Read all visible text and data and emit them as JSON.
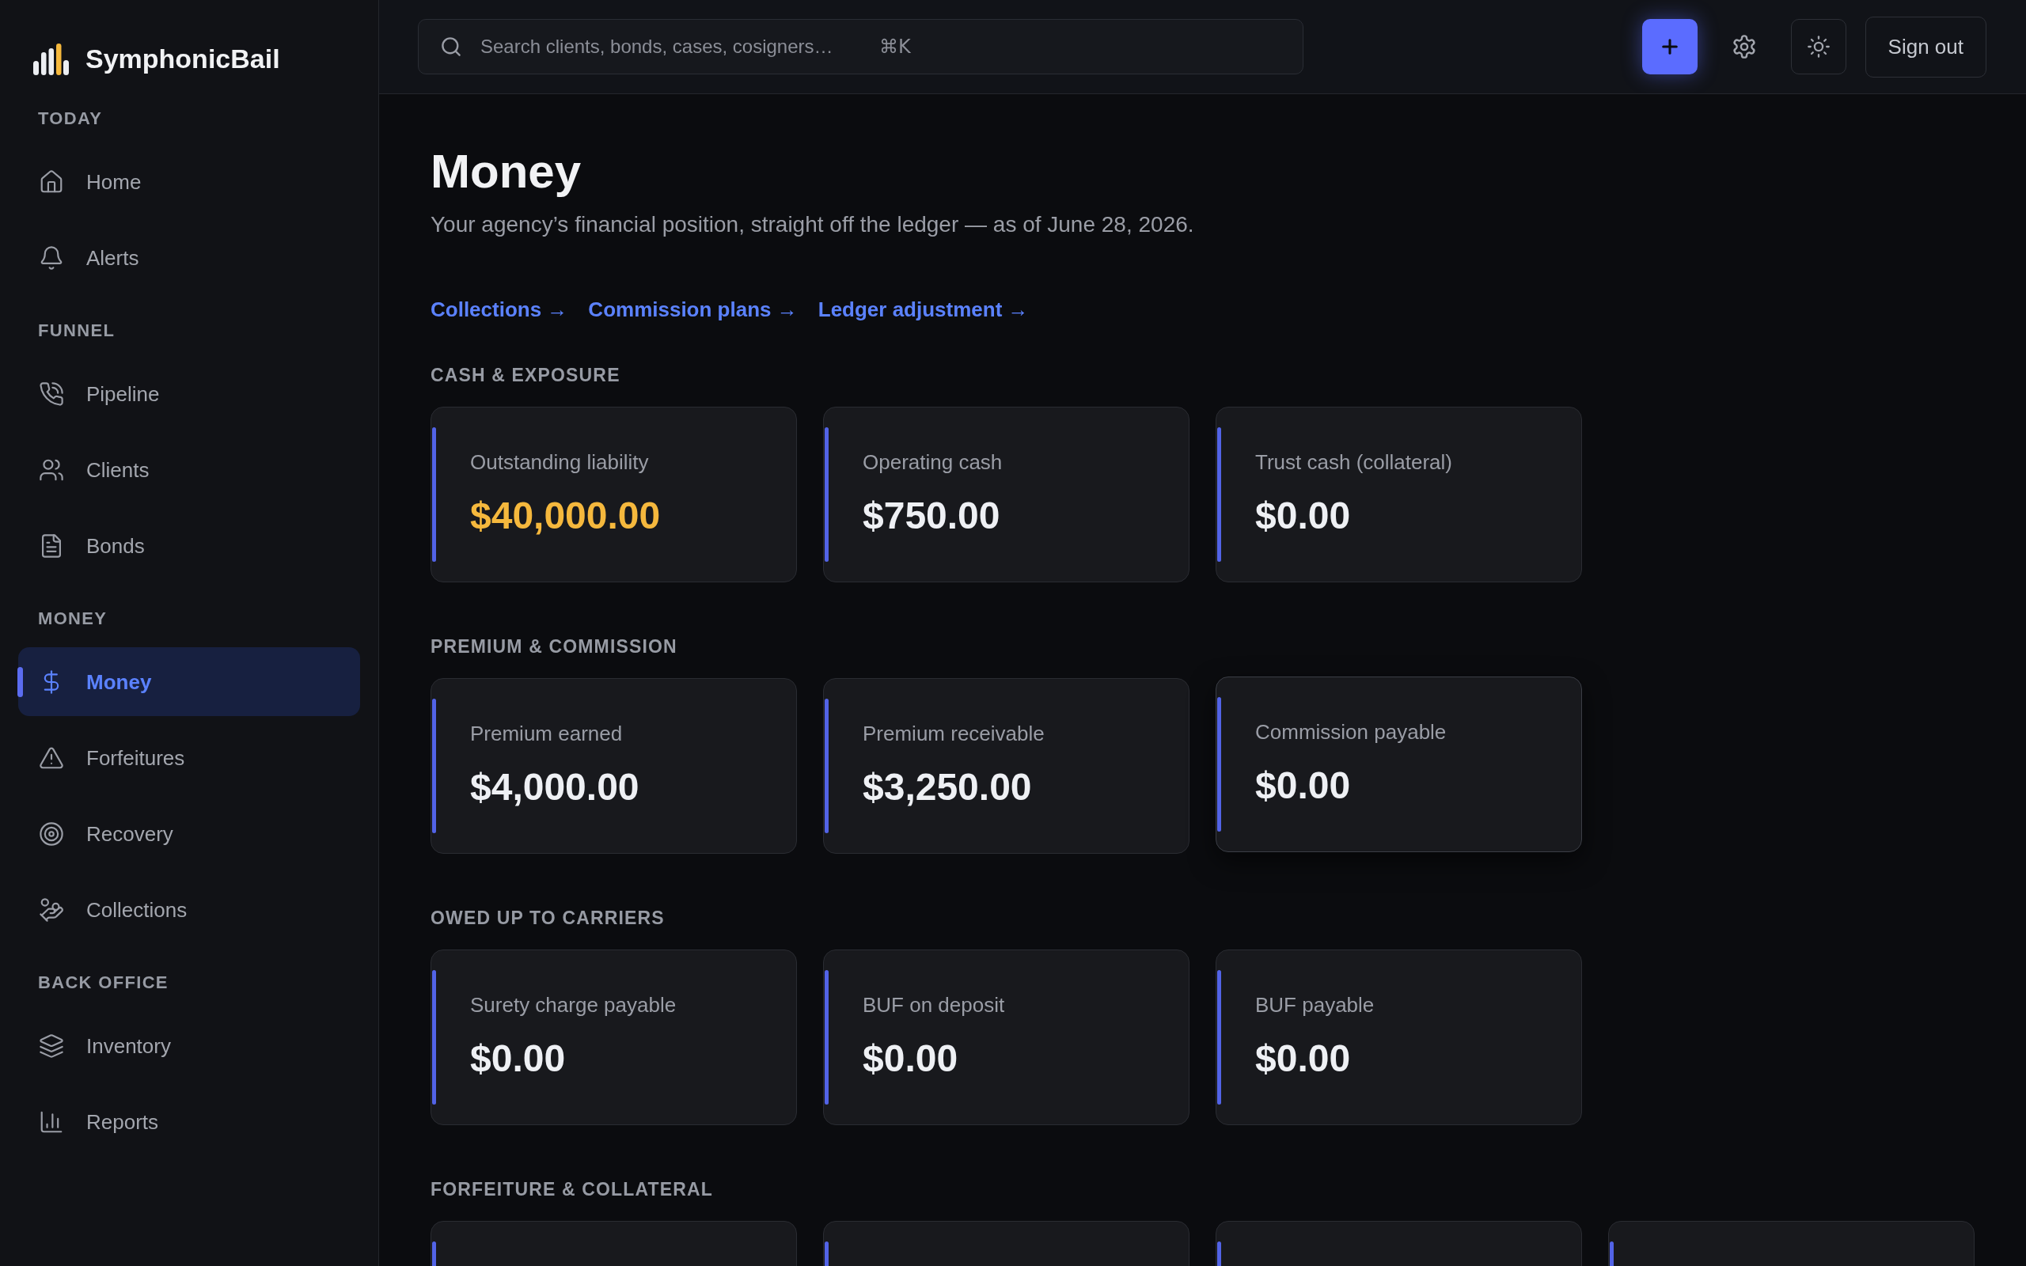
{
  "sidebar": {
    "brand": "SymphonicBail",
    "sections": [
      {
        "heading": "TODAY",
        "items": [
          {
            "label": "Home",
            "selected": false
          },
          {
            "label": "Alerts",
            "selected": false
          }
        ]
      },
      {
        "heading": "FUNNEL",
        "items": [
          {
            "label": "Pipeline",
            "selected": false
          },
          {
            "label": "Clients",
            "selected": false
          },
          {
            "label": "Bonds",
            "selected": false
          }
        ]
      },
      {
        "heading": "MONEY",
        "items": [
          {
            "label": "Money",
            "selected": true
          },
          {
            "label": "Forfeitures",
            "selected": false
          },
          {
            "label": "Recovery",
            "selected": false
          },
          {
            "label": "Collections",
            "selected": false
          }
        ]
      },
      {
        "heading": "BACK OFFICE",
        "items": [
          {
            "label": "Inventory",
            "selected": false
          },
          {
            "label": "Reports",
            "selected": false
          }
        ]
      }
    ]
  },
  "topbar": {
    "search": {
      "placeholder": "Search clients, bonds, cases, cosigners…",
      "shortcut": "⌘K"
    },
    "sign_out": "Sign out"
  },
  "page": {
    "title": "Money",
    "subtitle": "Your agency’s financial position, straight off the ledger — as of June 28, 2026.",
    "links": [
      "Collections →",
      "Commission plans →",
      "Ledger adjustment →"
    ],
    "sections": [
      {
        "heading": "CASH & EXPOSURE",
        "cards": [
          {
            "label": "Outstanding liability",
            "value": "$40,000.00",
            "warning": true,
            "hovered": false
          },
          {
            "label": "Operating cash",
            "value": "$750.00",
            "warning": false,
            "hovered": false
          },
          {
            "label": "Trust cash (collateral)",
            "value": "$0.00",
            "warning": false,
            "hovered": false
          }
        ]
      },
      {
        "heading": "PREMIUM & COMMISSION",
        "cards": [
          {
            "label": "Premium earned",
            "value": "$4,000.00",
            "warning": false,
            "hovered": false
          },
          {
            "label": "Premium receivable",
            "value": "$3,250.00",
            "warning": false,
            "hovered": false
          },
          {
            "label": "Commission payable",
            "value": "$0.00",
            "warning": false,
            "hovered": true
          }
        ]
      },
      {
        "heading": "OWED UP TO CARRIERS",
        "cards": [
          {
            "label": "Surety charge payable",
            "value": "$0.00",
            "warning": false,
            "hovered": false
          },
          {
            "label": "BUF on deposit",
            "value": "$0.00",
            "warning": false,
            "hovered": false
          },
          {
            "label": "BUF payable",
            "value": "$0.00",
            "warning": false,
            "hovered": false
          }
        ]
      },
      {
        "heading": "FORFEITURE & COLLATERAL",
        "cards": [
          {
            "hovered": false
          },
          {
            "hovered": false
          },
          {
            "hovered": false
          },
          {
            "hovered": false
          }
        ]
      }
    ]
  }
}
